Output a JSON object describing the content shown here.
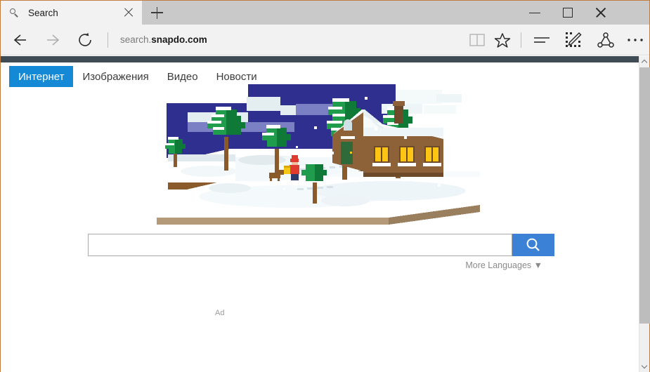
{
  "browser": {
    "tab": {
      "title": "Search",
      "favicon": "search-icon",
      "close": "close-icon"
    },
    "new_tab": "+",
    "window_controls": {
      "minimize": "minimize-icon",
      "maximize": "maximize-icon",
      "close": "close-icon"
    },
    "toolbar": {
      "back": "back-arrow-icon",
      "forward": "forward-arrow-icon",
      "reload": "reload-icon",
      "reading_view": "book-icon",
      "favorites": "star-icon",
      "hub": "hub-lines-icon",
      "web_note": "pencil-note-icon",
      "share": "share-icon",
      "more": "more-ellipsis-icon"
    },
    "address": {
      "prefix": "search.",
      "domain": "snapdo.com",
      "full": "search.snapdo.com"
    }
  },
  "page": {
    "nav_tabs": [
      {
        "label": "Интернет",
        "active": true
      },
      {
        "label": "Изображения",
        "active": false
      },
      {
        "label": "Видео",
        "active": false
      },
      {
        "label": "Новости",
        "active": false
      }
    ],
    "search": {
      "value": "",
      "placeholder": "",
      "button_icon": "search-icon",
      "more_languages": "More Languages ▼"
    },
    "ad_label": "Ad",
    "illustration": {
      "name": "winter-cabin-pixel-art",
      "description": "Isometric pixel-art winter scene: night sky, snow-covered terraced ground, pine trees, cabin with lit windows, person with basket and a dog"
    },
    "scrollbar": {
      "up": "chevron-up-icon",
      "down": "chevron-down-icon",
      "thumb": "scrollbar-thumb"
    }
  },
  "colors": {
    "accent_blue": "#1489d6",
    "search_button_blue": "#3b82d6",
    "top_strip": "#3f4b55",
    "titlebar": "#c9c9c9",
    "navbar": "#f2f2f2",
    "window_border": "#c17c3e",
    "sky_navy": "#2e2f8f",
    "cloud_lavender": "#7b7fc4",
    "cloud_pale": "#e4edf0",
    "snow_white": "#ffffff",
    "snow_shadow": "#e9f1f4",
    "tree_green": "#1f9d4d",
    "tree_green_dark": "#0f7a37",
    "trunk_brown": "#8a5a2b",
    "cabin_brown": "#8d6239",
    "cabin_brown_dark": "#6d4a2a",
    "window_glow": "#ffc515",
    "figure_red": "#e03b2f",
    "basket_yellow": "#f5c518"
  }
}
